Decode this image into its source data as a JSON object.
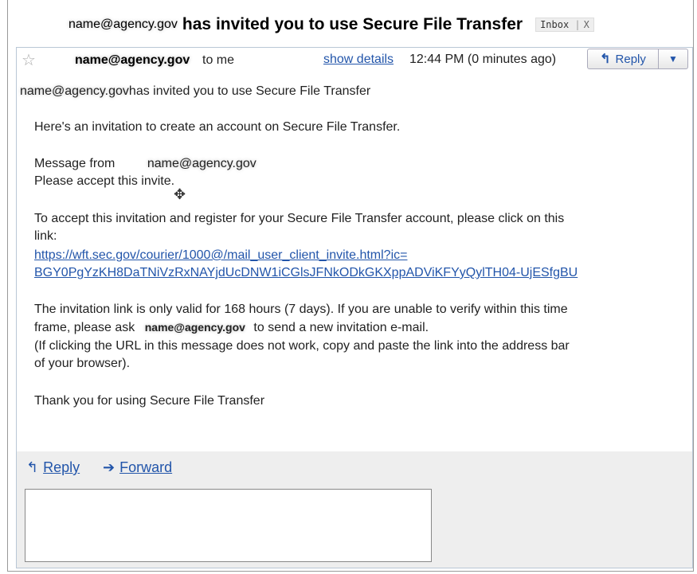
{
  "subject": {
    "sender": "name@agency.gov",
    "text": "has invited you to use Secure File Transfer",
    "label": "Inbox",
    "label_close": "X"
  },
  "header": {
    "sender": "name@agency.gov",
    "to": "to me",
    "show_details": "show details",
    "time": "12:44 PM (0 minutes ago)",
    "reply_label": "Reply"
  },
  "body": {
    "invite_sender": "name@agency.gov",
    "invite_line": "has invited you to use Secure File Transfer",
    "line1": "Here's an invitation to create an account on Secure File Transfer.",
    "message_from": "Message from",
    "message_from_name": "name@agency.gov",
    "please_accept": "Please accept this invite.",
    "accept_line1": "To accept this invitation and register for your Secure File Transfer account, please click on this",
    "accept_line2": "link:",
    "link_line1": "https://wft.sec.gov/courier/1000@/mail_user_client_invite.html?ic=",
    "link_line2": "BGY0PgYzKH8DaTNiVzRxNAYjdUcDNW1iCGlsJFNkODkGKXppADViKFYyQylTH04-UjESfgBU",
    "valid_line1": "The invitation link is only valid for 168 hours (7 days). If you are unable to verify within this time",
    "valid_line2_pre": "frame, please ask",
    "valid_line2_name": "name@agency.gov",
    "valid_line2_post": "to send a new invitation e-mail.",
    "paren_line1": "(If clicking the URL in this message does not work, copy and paste the link into the address bar",
    "paren_line2": "of your browser).",
    "thanks": "Thank you for using Secure File Transfer"
  },
  "footer": {
    "reply": "Reply",
    "forward": "Forward"
  },
  "colors": {
    "link": "#2255aa",
    "footer_bg": "#eeeeee",
    "border": "#b9c7d6"
  }
}
